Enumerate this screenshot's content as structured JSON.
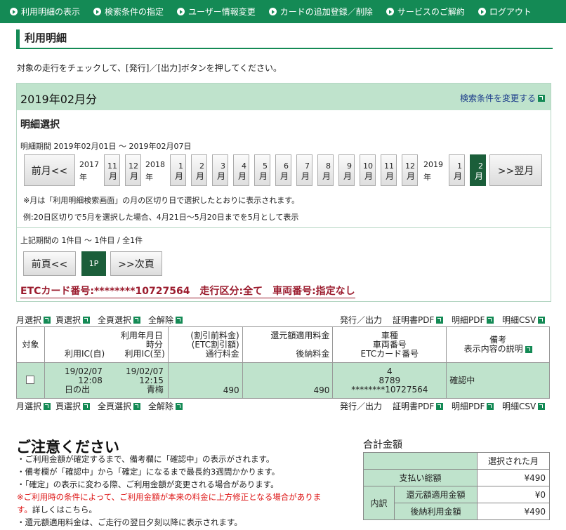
{
  "nav": {
    "items": [
      "利用明細の表示",
      "検索条件の指定",
      "ユーザー情報変更",
      "カードの追加登録／削除",
      "サービスのご解約",
      "ログアウト"
    ]
  },
  "page": {
    "title": "利用明細",
    "instruction": "対象の走行をチェックして、[発行]／[出力]ボタンを押してください。"
  },
  "month_box": {
    "title": "2019年02月分",
    "change_link": "検索条件を変更する",
    "section_title": "明細選択",
    "period": "明細期間 2019年02月01日 〜 2019年02月07日",
    "prev_btn": "前月<<",
    "next_btn": ">>翌月",
    "year_2017": "2017",
    "year_2018": "2018",
    "year_2019": "2019",
    "year_unit": "年",
    "month_unit": "月",
    "months_2017": [
      "11",
      "12"
    ],
    "months_2018": [
      "1",
      "2",
      "3",
      "4",
      "5",
      "6",
      "7",
      "8",
      "9",
      "10",
      "11",
      "12"
    ],
    "months_2019": [
      "1",
      "2"
    ],
    "active_month": "2019-2",
    "note1": "※月は「利用明細検索画面」の月の区切り日で選択したとおりに表示されます。",
    "note2": "例:20日区切りで5月を選択した場合、4月21日〜5月20日までを5月として表示",
    "page_info": "上記期間の 1件目 〜 1件目 / 全1件",
    "prev_page": "前頁<<",
    "current_page": "1P",
    "next_page": ">>次頁",
    "etc_line": "ETCカード番号:********10727564　走行区分:全て　車両番号:指定なし"
  },
  "actions": {
    "select_month": "月選択",
    "select_page": "頁選択",
    "select_all": "全頁選択",
    "deselect_all": "全解除",
    "issue_output": "発行／出力",
    "certificate_pdf": "証明書PDF",
    "detail_pdf": "明細PDF",
    "detail_csv": "明細CSV"
  },
  "table": {
    "headers": {
      "target": "対象",
      "date_top": "利用年月日",
      "date_time": "時分",
      "ic_in": "利用IC(自)",
      "ic_out": "利用IC(至)",
      "fare1": "(割引前料金)",
      "fare2": "(ETC割引額)",
      "fare3": "通行料金",
      "rebate1": "還元額適用料金",
      "rebate2": "後納料金",
      "vehicle1": "車種",
      "vehicle2": "車両番号",
      "vehicle3": "ETCカード番号",
      "remarks1": "備考",
      "remarks2": "表示内容の説明"
    },
    "rows": [
      {
        "date_in": "19/02/07",
        "time_in": "12:08",
        "ic_in": "日の出",
        "date_out": "19/02/07",
        "time_out": "12:15",
        "ic_out": "青梅",
        "toll": "490",
        "deferred": "490",
        "vehicle_type": "4",
        "vehicle_no": "8789",
        "card_no": "********10727564",
        "remarks": "確認中",
        "checked": false
      }
    ]
  },
  "caution": {
    "title": "ご注意ください",
    "lines": [
      "・ご利用金額が確定するまで、備考欄に「確認中」の表示がされます。",
      "・備考欄が「確認中」から「確定」になるまで最長約3週間かかります。",
      "・「確定」の表示に変わる際、ご利用金額が変更される場合があります。"
    ],
    "red_line1": "※ご利用時の条件によって、ご利用金額が本来の料金に上方修正となる場合がありま",
    "red_line2": "す。",
    "detail_text": "詳しくはこちら。",
    "last_line": "・還元額適用料金は、ご走行の翌日夕刻以降に表示されます。"
  },
  "total": {
    "title": "合計金額",
    "col_header": "選択された月",
    "total_label": "支払い総額",
    "total_value": "¥490",
    "breakdown_label": "内訳",
    "rebate_label": "還元額適用金額",
    "rebate_value": "¥0",
    "deferred_label": "後納利用金額",
    "deferred_value": "¥490"
  },
  "colors": {
    "nav_green": "#148a55",
    "light_green": "#bfe3cc",
    "active_month": "#1b5e3a",
    "etc_red": "#9b1c2e"
  }
}
